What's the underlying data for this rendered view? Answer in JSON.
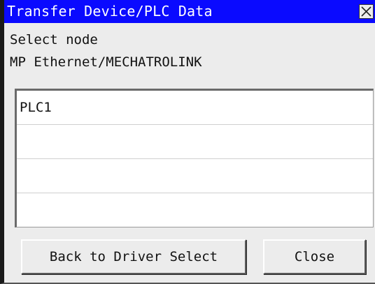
{
  "window": {
    "title": "Transfer Device/PLC Data",
    "close_icon": "close-x-icon",
    "title_bg_color": "#0a0aff"
  },
  "prompt": "Select node",
  "driver_name": "MP Ethernet/MECHATROLINK",
  "node_list": {
    "items": [
      "PLC1",
      "",
      "",
      ""
    ]
  },
  "buttons": {
    "back_label": "Back to Driver Select",
    "close_label": "Close"
  }
}
